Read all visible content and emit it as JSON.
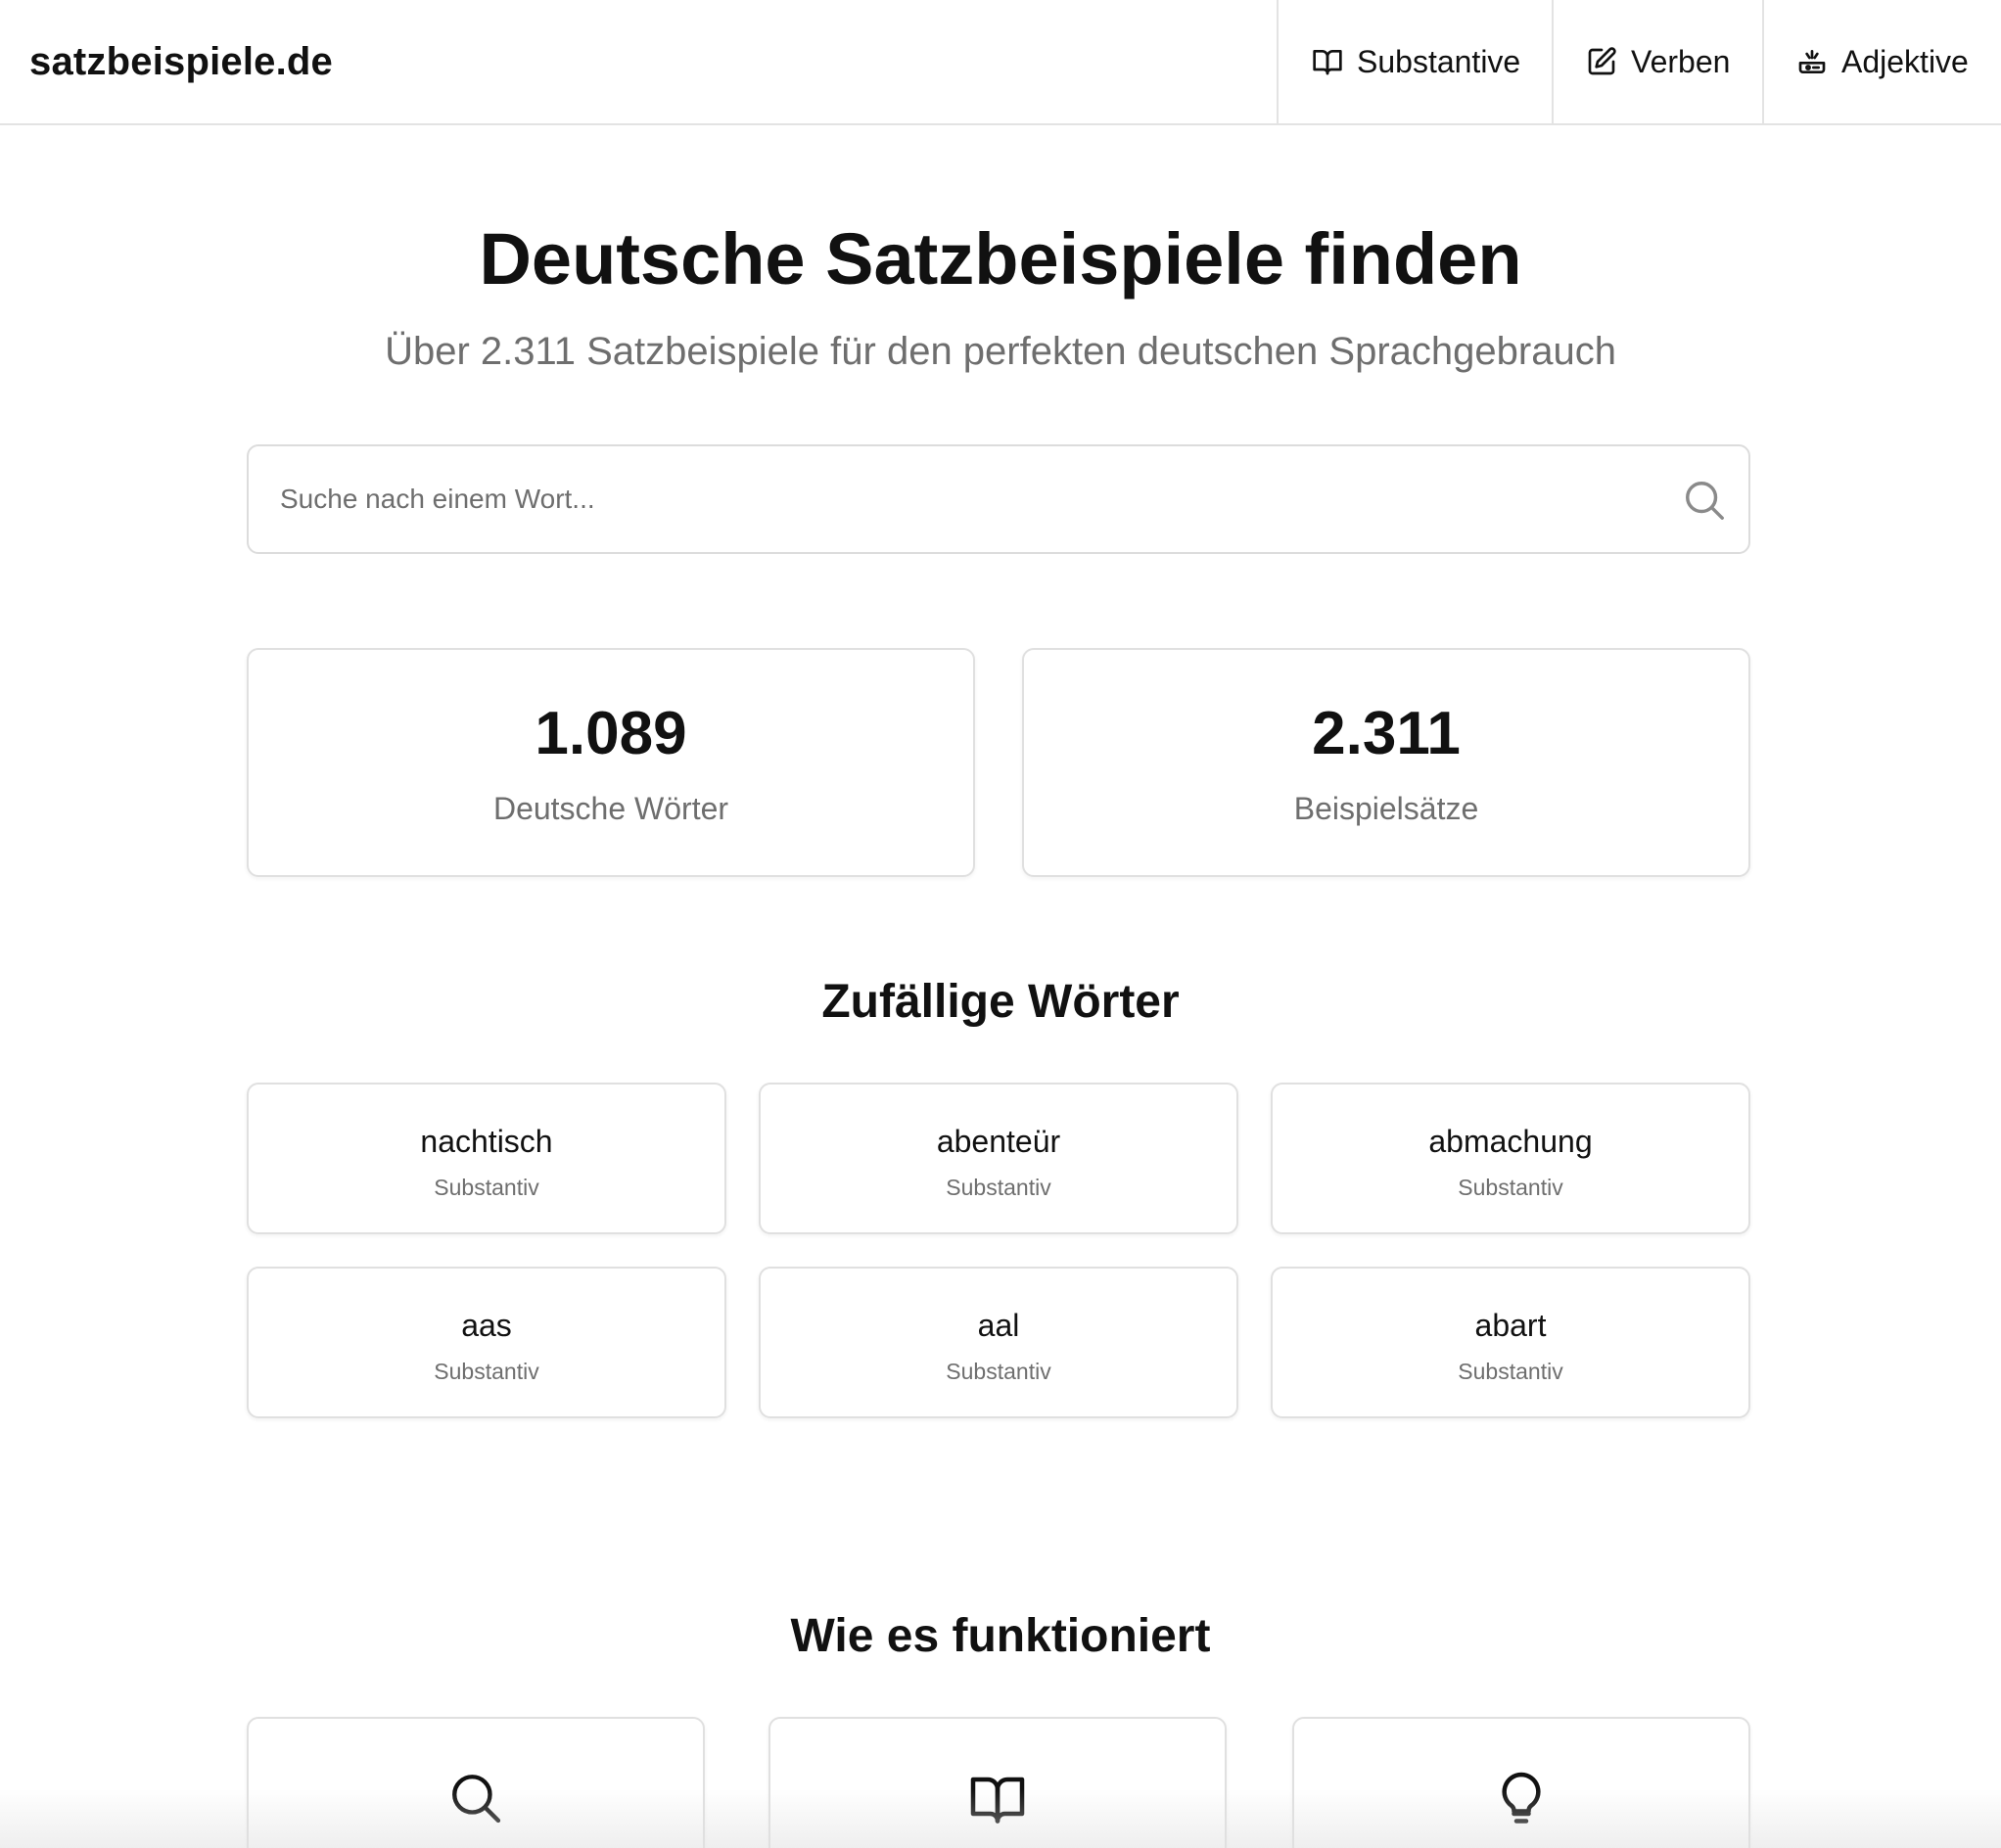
{
  "header": {
    "logo": "satzbeispiele.de",
    "nav": [
      {
        "label": "Substantive",
        "icon": "book-open-icon"
      },
      {
        "label": "Verben",
        "icon": "edit-icon"
      },
      {
        "label": "Adjektive",
        "icon": "sparkle-bowl-icon"
      }
    ]
  },
  "hero": {
    "title": "Deutsche Satzbeispiele finden",
    "subtitle": "Über 2.311 Satzbeispiele für den perfekten deutschen Sprachgebrauch"
  },
  "search": {
    "placeholder": "Suche nach einem Wort...",
    "value": "",
    "icon": "search-icon"
  },
  "stats": [
    {
      "value": "1.089",
      "label": "Deutsche Wörter"
    },
    {
      "value": "2.311",
      "label": "Beispielsätze"
    }
  ],
  "random_words": {
    "title": "Zufällige Wörter",
    "items": [
      {
        "word": "nachtisch",
        "type": "Substantiv"
      },
      {
        "word": "abenteür",
        "type": "Substantiv"
      },
      {
        "word": "abmachung",
        "type": "Substantiv"
      },
      {
        "word": "aas",
        "type": "Substantiv"
      },
      {
        "word": "aal",
        "type": "Substantiv"
      },
      {
        "word": "abart",
        "type": "Substantiv"
      }
    ]
  },
  "how_it_works": {
    "title": "Wie es funktioniert",
    "cards": [
      {
        "icon": "search-icon"
      },
      {
        "icon": "book-open-icon"
      },
      {
        "icon": "lightbulb-icon"
      }
    ]
  }
}
